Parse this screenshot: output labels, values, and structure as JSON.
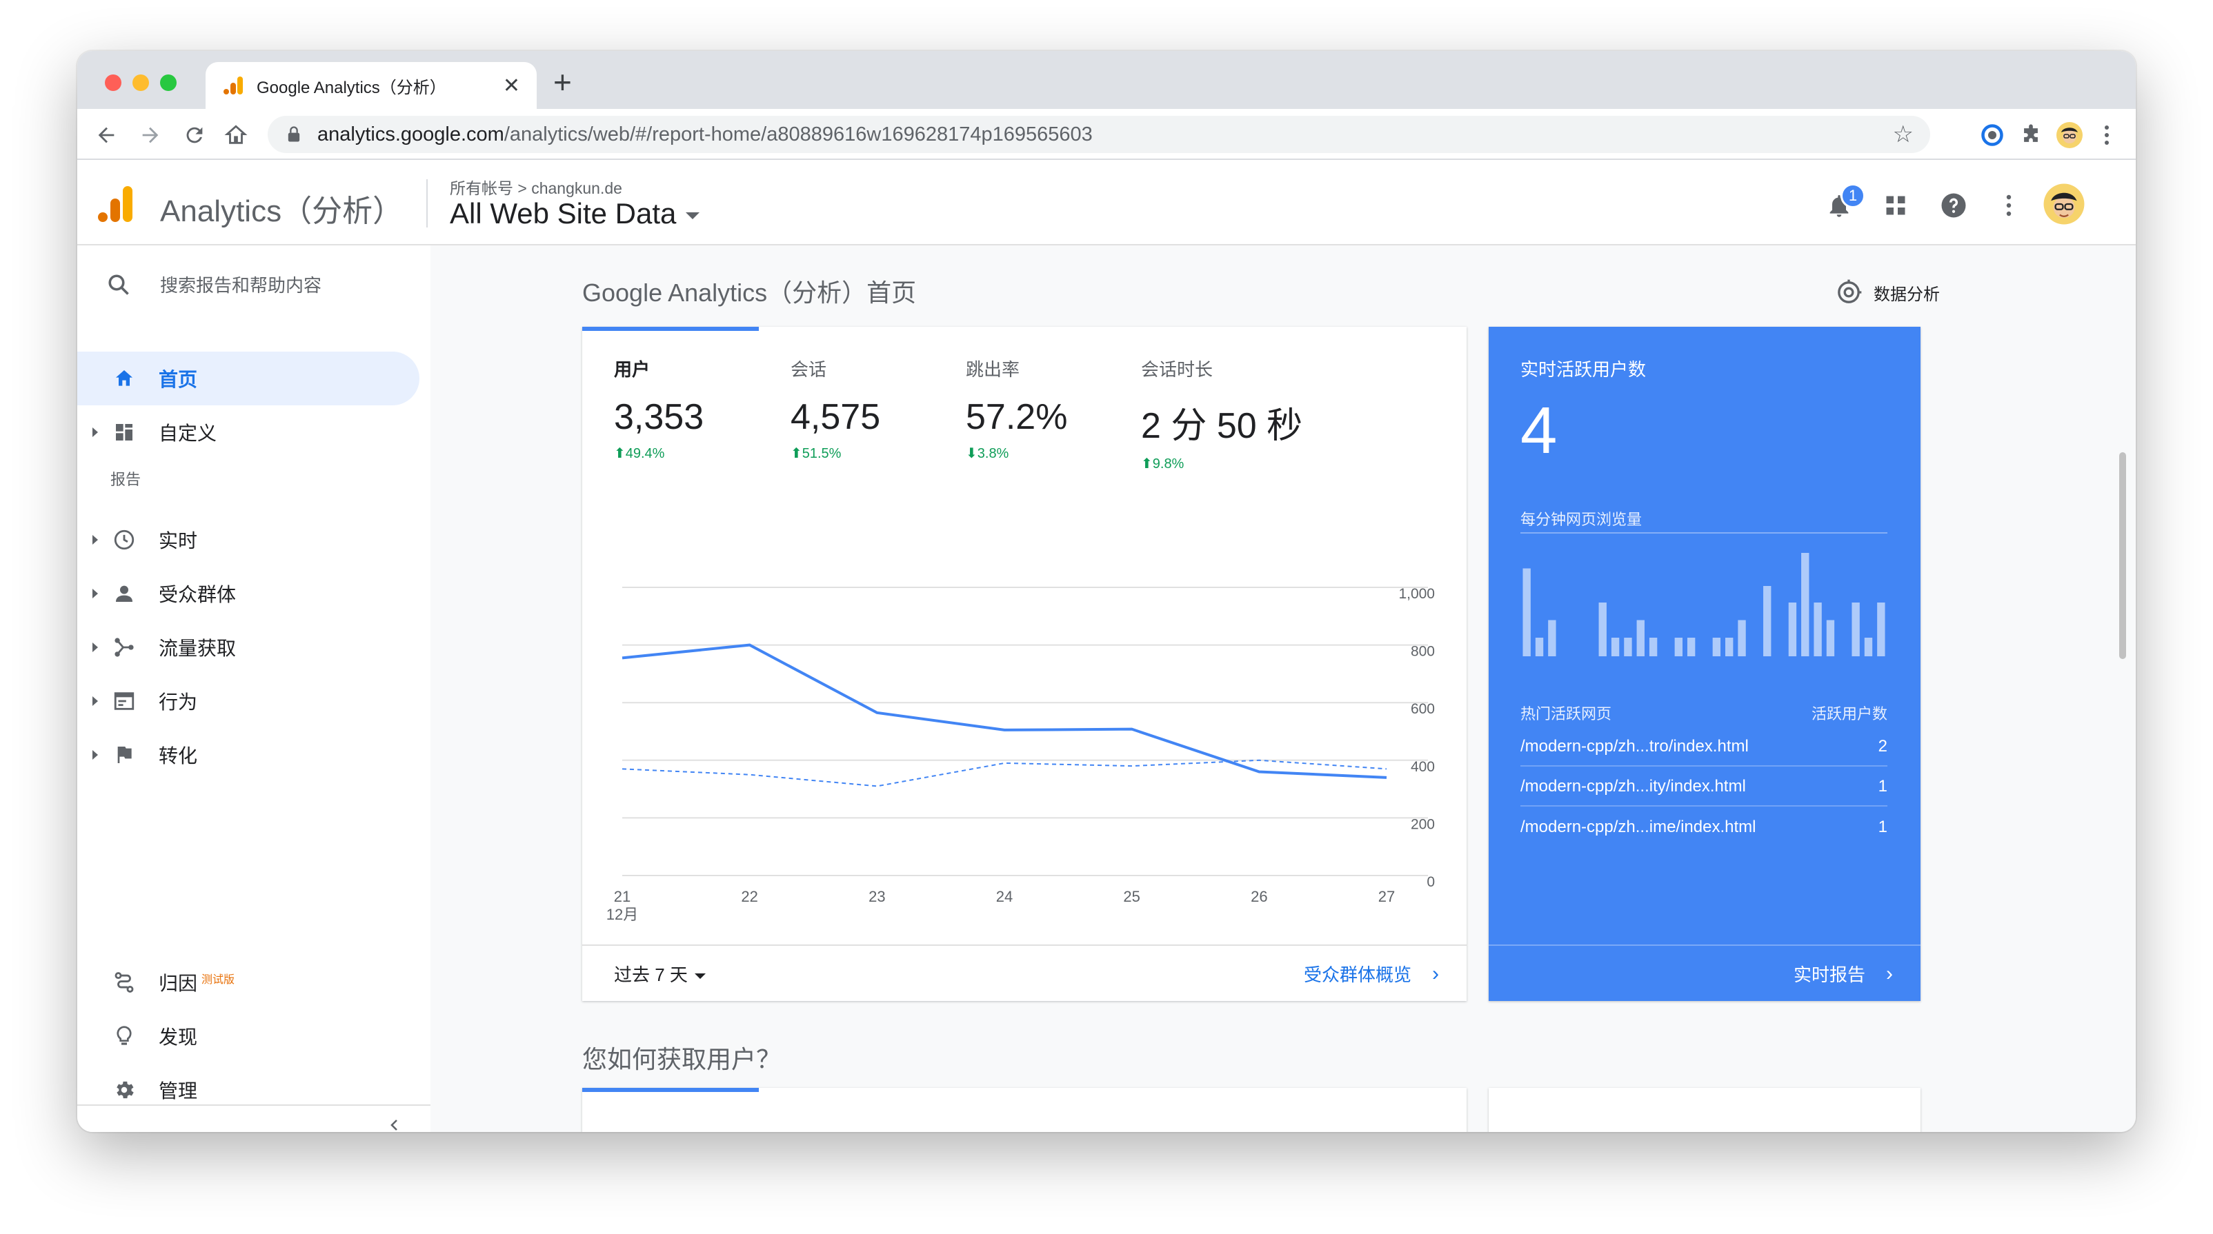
{
  "browser": {
    "tab_title": "Google Analytics（分析）",
    "tab_close": "✕",
    "new_tab": "+",
    "url_host": "analytics.google.com",
    "url_path": "/analytics/web/#/report-home/a80889616w169628174p169565603"
  },
  "header": {
    "app_name": "Analytics（分析）",
    "breadcrumb": "所有帐号 > changkun.de",
    "property": "All Web Site Data",
    "notification_count": "1"
  },
  "sidebar": {
    "search_placeholder": "搜索报告和帮助内容",
    "items": [
      {
        "label": "首页"
      },
      {
        "label": "自定义"
      }
    ],
    "reports_label": "报告",
    "reports": [
      {
        "label": "实时"
      },
      {
        "label": "受众群体"
      },
      {
        "label": "流量获取"
      },
      {
        "label": "行为"
      },
      {
        "label": "转化"
      }
    ],
    "bottom": [
      {
        "label": "归因",
        "badge": "测试版"
      },
      {
        "label": "发现"
      },
      {
        "label": "管理"
      }
    ]
  },
  "main": {
    "page_title": "Google Analytics（分析）首页",
    "insights_label": "数据分析",
    "metrics": [
      {
        "label": "用户",
        "value": "3,353",
        "change": "⬆49.4%"
      },
      {
        "label": "会话",
        "value": "4,575",
        "change": "⬆51.5%"
      },
      {
        "label": "跳出率",
        "value": "57.2%",
        "change": "⬇3.8%"
      },
      {
        "label": "会话时长",
        "value": "2 分 50 秒",
        "change": "⬆9.8%"
      }
    ],
    "period_label": "过去 7 天",
    "audience_link": "受众群体概览",
    "section2_title": "您如何获取用户？"
  },
  "realtime": {
    "title": "实时活跃用户数",
    "count": "4",
    "pageviews_label": "每分钟网页浏览量",
    "pageviews_per_minute": [
      0.85,
      0.18,
      0.35,
      0,
      0,
      0,
      0.52,
      0.18,
      0.18,
      0.35,
      0.18,
      0,
      0.18,
      0.18,
      0,
      0.18,
      0.18,
      0.35,
      0,
      0.68,
      0,
      0.52,
      1.0,
      0.52,
      0.35,
      0,
      0.52,
      0.18,
      0.52
    ],
    "table_header_page": "热门活跃网页",
    "table_header_users": "活跃用户数",
    "rows": [
      {
        "page": "/modern-cpp/zh...tro/index.html",
        "users": "2"
      },
      {
        "page": "/modern-cpp/zh...ity/index.html",
        "users": "1"
      },
      {
        "page": "/modern-cpp/zh...ime/index.html",
        "users": "1"
      }
    ],
    "link": "实时报告"
  },
  "chart_data": {
    "type": "line",
    "x": [
      "21",
      "22",
      "23",
      "24",
      "25",
      "26",
      "27"
    ],
    "x_sublabel": "12月",
    "series": [
      {
        "values": [
          755,
          800,
          565,
          505,
          508,
          360,
          340
        ],
        "style": "solid",
        "color": "#4285f4"
      },
      {
        "values": [
          370,
          350,
          310,
          390,
          380,
          400,
          370
        ],
        "style": "dashed",
        "color": "#4285f4"
      }
    ],
    "y_ticks": [
      "1,000",
      "800",
      "600",
      "400",
      "200",
      "0"
    ],
    "ylim": [
      0,
      1000
    ],
    "grid": true
  }
}
